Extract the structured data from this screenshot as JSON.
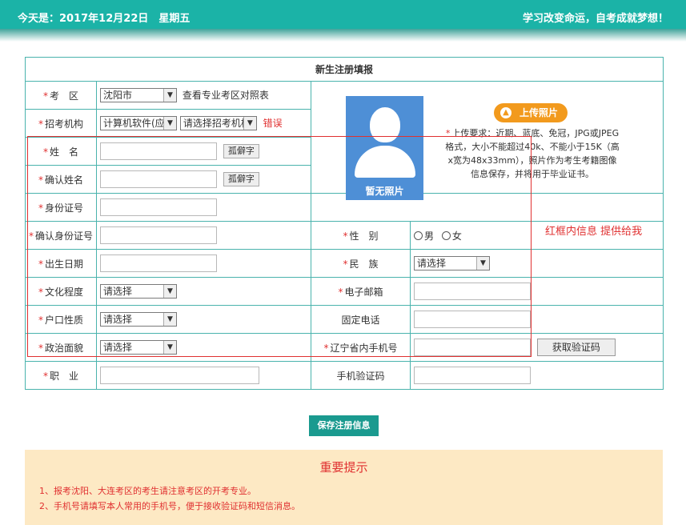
{
  "header": {
    "date_text": "今天是：2017年12月22日　星期五",
    "slogan": "学习改变命运，自考成就梦想！"
  },
  "form": {
    "title": "新生注册填报",
    "required_mark": "*",
    "exam_area": {
      "label": "考　区",
      "value": "沈阳市",
      "link": "查看专业考区对照表"
    },
    "institution": {
      "label": "招考机构",
      "value": "计算机软件(应",
      "select_value": "请选择招考机构",
      "error": "错误"
    },
    "name": {
      "label": "姓　名",
      "rare_btn": "孤僻字"
    },
    "confirm_name": {
      "label": "确认姓名",
      "rare_btn": "孤僻字"
    },
    "id_number": {
      "label": "身份证号"
    },
    "confirm_id": {
      "label": "确认身份证号"
    },
    "birth_date": {
      "label": "出生日期"
    },
    "education": {
      "label": "文化程度",
      "value": "请选择"
    },
    "household": {
      "label": "户口性质",
      "value": "请选择"
    },
    "political": {
      "label": "政治面貌",
      "value": "请选择"
    },
    "occupation": {
      "label": "职　业"
    },
    "gender": {
      "label": "性　别",
      "male": "男",
      "female": "女"
    },
    "ethnicity": {
      "label": "民　族",
      "value": "请选择"
    },
    "email": {
      "label": "电子邮箱"
    },
    "landline": {
      "label": "固定电话"
    },
    "mobile": {
      "label": "辽宁省内手机号",
      "code_btn": "获取验证码"
    },
    "sms_code": {
      "label": "手机验证码"
    }
  },
  "photo": {
    "placeholder": "暂无照片",
    "upload_btn": "上传照片",
    "requirement": "上传要求：近期、蓝底、免冠，JPG或JPEG格式，大小不能超过40k、不能小于15K（高x宽为48x33mm），照片作为考生考籍图像信息保存，并将用于毕业证书。"
  },
  "annotation": {
    "red_note": "红框内信息 提供给我"
  },
  "actions": {
    "save": "保存注册信息"
  },
  "notice": {
    "title": "重要提示",
    "items": [
      "1、报考沈阳、大连考区的考生请注意考区的开考专业。",
      "2、手机号请填写本人常用的手机号，便于接收验证码和短信消息。"
    ]
  },
  "colors": {
    "header": "#1bb3a7",
    "border": "#4ab3ad",
    "upload": "#f29a1d",
    "save": "#1a9a8f",
    "notice_bg": "#fde9c4",
    "alert": "#e03030"
  }
}
